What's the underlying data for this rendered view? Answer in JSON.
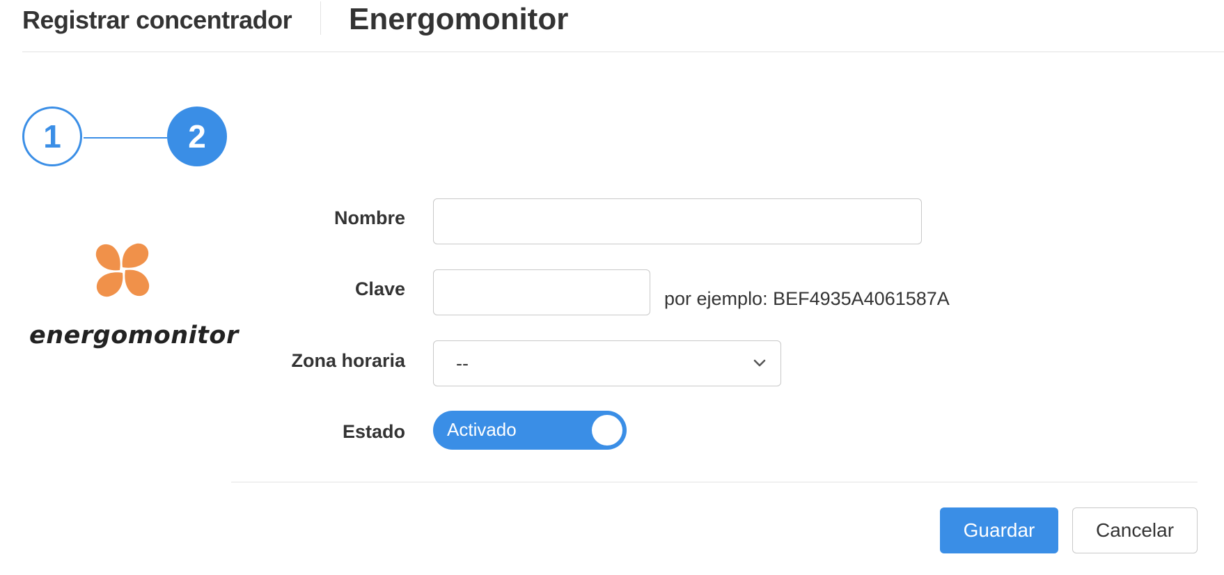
{
  "header": {
    "breadcrumb": "Registrar concentrador",
    "title": "Energomonitor"
  },
  "stepper": {
    "steps": [
      "1",
      "2"
    ],
    "active_step": 2
  },
  "logo": {
    "text": "energomonitor",
    "icon_name": "energomonitor-logo-icon",
    "brand_color": "#f0914a"
  },
  "form": {
    "name_label": "Nombre",
    "name_value": "",
    "key_label": "Clave",
    "key_value": "",
    "key_hint": "por ejemplo: BEF4935A4061587A",
    "timezone_label": "Zona horaria",
    "timezone_value": "--",
    "state_label": "Estado",
    "state_value": "Activado"
  },
  "actions": {
    "save_label": "Guardar",
    "cancel_label": "Cancelar"
  },
  "colors": {
    "accent": "#3a8ee6",
    "text": "#333333",
    "border": "#c8c8c8"
  }
}
